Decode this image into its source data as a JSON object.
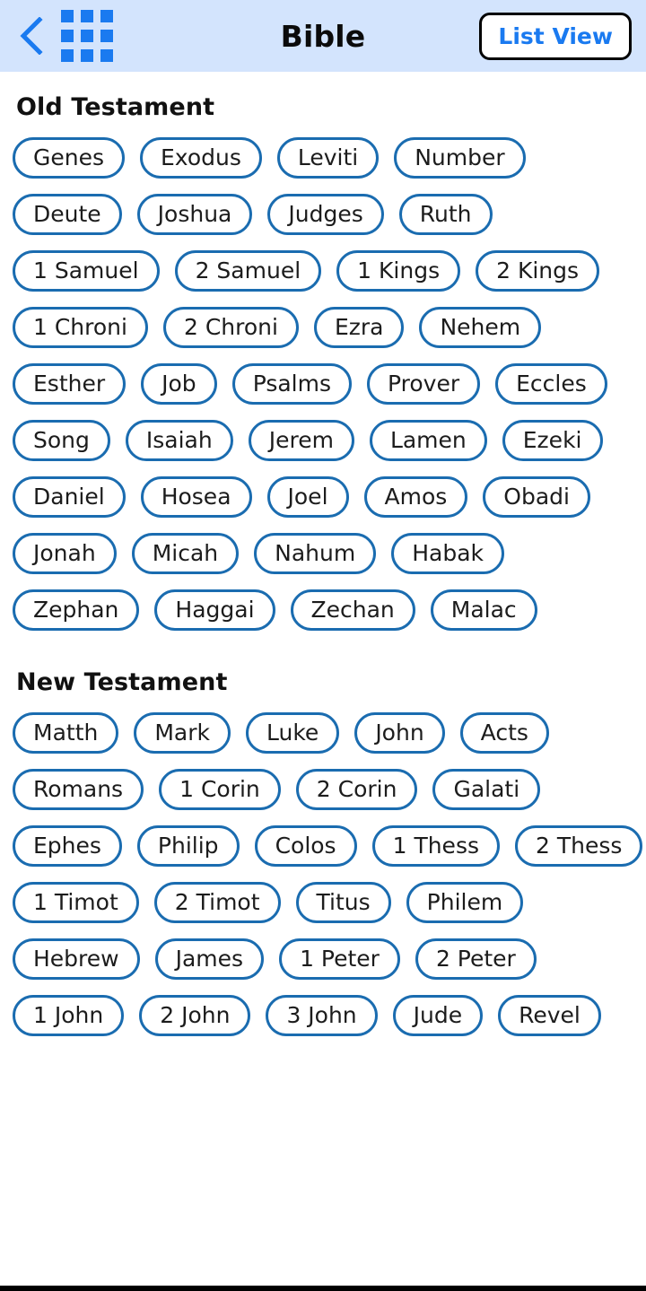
{
  "header": {
    "back_icon": "back-chevron-icon",
    "grid_icon": "grid-3x3-icon",
    "title": "Bible",
    "list_view_label": "List View",
    "bg_color": "#d3e4fd",
    "accent_color": "#1a7af0"
  },
  "sections": [
    {
      "title": "Old Testament",
      "rows": [
        [
          "Genes",
          "Exodus",
          "Leviti",
          "Number"
        ],
        [
          "Deute",
          "Joshua",
          "Judges",
          "Ruth"
        ],
        [
          "1 Samuel",
          "2 Samuel",
          "1 Kings",
          "2 Kings"
        ],
        [
          "1 Chroni",
          "2 Chroni",
          "Ezra",
          "Nehem"
        ],
        [
          "Esther",
          "Job",
          "Psalms",
          "Prover",
          "Eccles"
        ],
        [
          "Song",
          "Isaiah",
          "Jerem",
          "Lamen",
          "Ezeki"
        ],
        [
          "Daniel",
          "Hosea",
          "Joel",
          "Amos",
          "Obadi"
        ],
        [
          "Jonah",
          "Micah",
          "Nahum",
          "Habak"
        ],
        [
          "Zephan",
          "Haggai",
          "Zechan",
          "Malac"
        ]
      ]
    },
    {
      "title": "New Testament",
      "rows": [
        [
          "Matth",
          "Mark",
          "Luke",
          "John",
          "Acts"
        ],
        [
          "Romans",
          "1 Corin",
          "2 Corin",
          "Galati"
        ],
        [
          "Ephes",
          "Philip",
          "Colos",
          "1 Thess",
          "2 Thess"
        ],
        [
          "1 Timot",
          "2 Timot",
          "Titus",
          "Philem"
        ],
        [
          "Hebrew",
          "James",
          "1 Peter",
          "2 Peter"
        ],
        [
          "1 John",
          "2 John",
          "3 John",
          "Jude",
          "Revel"
        ]
      ]
    }
  ],
  "theme": {
    "pill_border_color": "#1a6cb0",
    "pill_text_color": "#1c1c1c",
    "page_bg": "#ffffff",
    "bottom_bar_color": "#000000"
  }
}
